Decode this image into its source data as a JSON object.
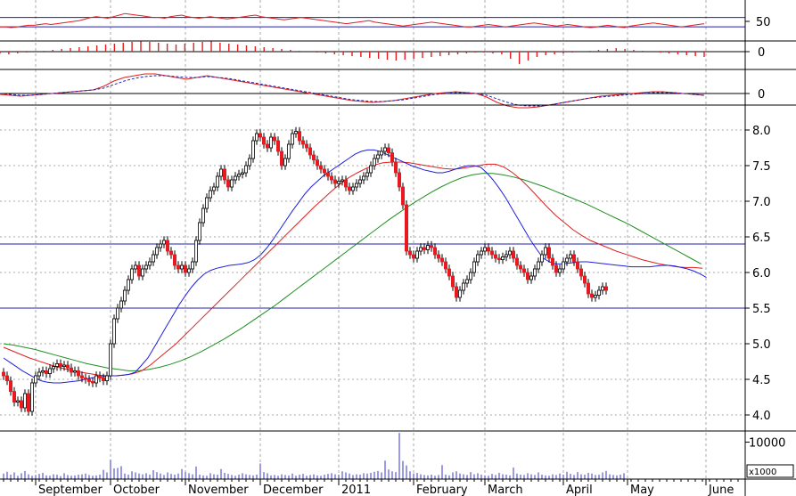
{
  "chart_data": {
    "type": "candlestick",
    "grid": true,
    "colors": {
      "background": "#ffffff",
      "up_candle": "#ffffff",
      "down_candle": "#e8191f",
      "candle_outline": "#000000",
      "ma_short": "#1f1fe0",
      "ma_mid": "#e01f1f",
      "ma_long": "#1f8f1f",
      "reference_line": "#1f1fb0",
      "grid": "#a8a8a8",
      "volume": "#3434d0",
      "volume_spike": "#e01f1f"
    },
    "x_labels": [
      {
        "label": "September",
        "day": 9
      },
      {
        "label": "October",
        "day": 30
      },
      {
        "label": "November",
        "day": 51
      },
      {
        "label": "December",
        "day": 72
      },
      {
        "label": "2011",
        "day": 94
      },
      {
        "label": "February",
        "day": 115
      },
      {
        "label": "March",
        "day": 135
      },
      {
        "label": "April",
        "day": 157
      },
      {
        "label": "May",
        "day": 175
      },
      {
        "label": "June",
        "day": 197
      }
    ],
    "price_panel": {
      "y_ticks": [
        4.0,
        4.5,
        5.0,
        5.5,
        6.0,
        6.5,
        7.0,
        7.5,
        8.0
      ],
      "ylim": [
        3.8,
        8.3
      ],
      "scale": "linear",
      "horizontal_lines": [
        6.4,
        5.5
      ],
      "close": [
        4.55,
        4.48,
        4.33,
        4.18,
        4.2,
        4.1,
        4.3,
        4.05,
        4.45,
        4.55,
        4.6,
        4.62,
        4.58,
        4.65,
        4.68,
        4.72,
        4.68,
        4.7,
        4.66,
        4.6,
        4.62,
        4.55,
        4.52,
        4.5,
        4.47,
        4.45,
        4.55,
        4.52,
        4.48,
        4.55,
        5.0,
        5.35,
        5.5,
        5.6,
        5.75,
        5.9,
        6.05,
        6.1,
        5.95,
        6.05,
        6.1,
        6.15,
        6.25,
        6.35,
        6.4,
        6.45,
        6.3,
        6.25,
        6.1,
        6.05,
        6.1,
        6.0,
        6.05,
        6.15,
        6.45,
        6.7,
        6.9,
        7.05,
        7.15,
        7.2,
        7.35,
        7.45,
        7.3,
        7.2,
        7.3,
        7.35,
        7.38,
        7.4,
        7.5,
        7.6,
        7.85,
        7.95,
        7.9,
        7.8,
        7.75,
        7.9,
        7.85,
        7.7,
        7.5,
        7.6,
        7.8,
        7.95,
        7.98,
        7.85,
        7.8,
        7.75,
        7.65,
        7.58,
        7.5,
        7.45,
        7.4,
        7.35,
        7.3,
        7.25,
        7.28,
        7.3,
        7.2,
        7.15,
        7.2,
        7.25,
        7.3,
        7.35,
        7.4,
        7.5,
        7.6,
        7.65,
        7.7,
        7.75,
        7.68,
        7.55,
        7.4,
        7.2,
        6.95,
        6.3,
        6.25,
        6.2,
        6.3,
        6.35,
        6.32,
        6.38,
        6.35,
        6.25,
        6.2,
        6.15,
        6.05,
        5.95,
        5.8,
        5.65,
        5.75,
        5.85,
        5.9,
        6.0,
        6.15,
        6.25,
        6.3,
        6.35,
        6.3,
        6.25,
        6.2,
        6.18,
        6.22,
        6.25,
        6.3,
        6.2,
        6.1,
        6.05,
        6.0,
        5.9,
        5.95,
        6.05,
        6.15,
        6.25,
        6.35,
        6.2,
        6.1,
        6.0,
        6.05,
        6.15,
        6.2,
        6.25,
        6.15,
        6.05,
        5.95,
        5.85,
        5.7,
        5.65,
        5.68,
        5.75,
        5.8,
        5.75
      ],
      "ma_short": [
        4.8,
        4.74,
        4.68,
        4.62,
        4.57,
        4.52,
        4.48,
        4.46,
        4.45,
        4.45,
        4.46,
        4.47,
        4.48,
        4.5,
        4.52,
        4.53,
        4.54,
        4.55,
        4.55,
        4.56,
        4.57,
        4.6,
        4.7,
        4.8,
        4.95,
        5.1,
        5.25,
        5.4,
        5.55,
        5.68,
        5.8,
        5.9,
        5.98,
        6.03,
        6.06,
        6.08,
        6.1,
        6.11,
        6.12,
        6.14,
        6.18,
        6.25,
        6.35,
        6.47,
        6.6,
        6.73,
        6.86,
        6.98,
        7.1,
        7.2,
        7.28,
        7.36,
        7.42,
        7.48,
        7.54,
        7.6,
        7.66,
        7.7,
        7.72,
        7.72,
        7.7,
        7.66,
        7.62,
        7.58,
        7.54,
        7.5,
        7.47,
        7.44,
        7.42,
        7.4,
        7.4,
        7.42,
        7.45,
        7.48,
        7.5,
        7.5,
        7.48,
        7.4,
        7.3,
        7.18,
        7.05,
        6.9,
        6.75,
        6.6,
        6.45,
        6.32,
        6.2,
        6.15,
        6.12,
        6.12,
        6.13,
        6.14,
        6.15,
        6.15,
        6.14,
        6.13,
        6.12,
        6.11,
        6.1,
        6.09,
        6.08,
        6.08,
        6.08,
        6.08,
        6.09,
        6.1,
        6.1,
        6.09,
        6.07,
        6.05,
        6.02,
        5.98,
        5.93
      ],
      "ma_mid": [
        4.95,
        4.9,
        4.85,
        4.8,
        4.76,
        4.72,
        4.68,
        4.65,
        4.62,
        4.6,
        4.58,
        4.56,
        4.55,
        4.55,
        4.56,
        4.58,
        4.62,
        4.7,
        4.8,
        4.9,
        5.0,
        5.12,
        5.24,
        5.36,
        5.48,
        5.6,
        5.72,
        5.84,
        5.96,
        6.08,
        6.2,
        6.32,
        6.44,
        6.56,
        6.68,
        6.8,
        6.92,
        7.03,
        7.14,
        7.24,
        7.33,
        7.4,
        7.46,
        7.51,
        7.54,
        7.55,
        7.55,
        7.54,
        7.52,
        7.5,
        7.48,
        7.46,
        7.45,
        7.46,
        7.48,
        7.5,
        7.52,
        7.52,
        7.48,
        7.4,
        7.3,
        7.18,
        7.05,
        6.92,
        6.8,
        6.7,
        6.6,
        6.52,
        6.45,
        6.4,
        6.35,
        6.3,
        6.26,
        6.22,
        6.18,
        6.15,
        6.12,
        6.1,
        6.08,
        6.07,
        6.07,
        6.06
      ],
      "ma_long": [
        5.0,
        4.98,
        4.95,
        4.92,
        4.88,
        4.84,
        4.8,
        4.76,
        4.72,
        4.69,
        4.66,
        4.64,
        4.62,
        4.62,
        4.64,
        4.67,
        4.71,
        4.76,
        4.82,
        4.89,
        4.97,
        5.05,
        5.14,
        5.23,
        5.33,
        5.43,
        5.53,
        5.64,
        5.75,
        5.86,
        5.97,
        6.08,
        6.19,
        6.3,
        6.41,
        6.52,
        6.63,
        6.74,
        6.84,
        6.94,
        7.03,
        7.12,
        7.2,
        7.27,
        7.33,
        7.37,
        7.39,
        7.39,
        7.37,
        7.34,
        7.3,
        7.25,
        7.2,
        7.14,
        7.08,
        7.02,
        6.96,
        6.89,
        6.82,
        6.75,
        6.68,
        6.6,
        6.52,
        6.44,
        6.36,
        6.28,
        6.2,
        6.12
      ],
      "ma_start_day": {
        "short": 0,
        "mid": 0,
        "long": 0
      },
      "ma_step": {
        "short": 1.76,
        "mid": 2.42,
        "long": 2.92
      }
    },
    "stoch_panel": {
      "y_ticks": [
        50
      ],
      "reference_lines": [
        60,
        36
      ],
      "ylim": [
        0,
        100
      ],
      "values": [
        36,
        36,
        34,
        36,
        38,
        40,
        40,
        42,
        44,
        42,
        44,
        46,
        48,
        50,
        52,
        56,
        60,
        62,
        60,
        58,
        62,
        66,
        70,
        68,
        66,
        64,
        62,
        60,
        60,
        58,
        62,
        64,
        66,
        62,
        60,
        58,
        60,
        62,
        60,
        58,
        56,
        58,
        60,
        62,
        64,
        66,
        62,
        60,
        58,
        56,
        54,
        56,
        58,
        60,
        58,
        56,
        54,
        52,
        50,
        48,
        46,
        44,
        46,
        48,
        50,
        52,
        48,
        46,
        44,
        42,
        40,
        38,
        40,
        42,
        44,
        46,
        48,
        46,
        44,
        42,
        40,
        38,
        36,
        36,
        38,
        40,
        42,
        40,
        38,
        36,
        38,
        40,
        42,
        44,
        46,
        44,
        42,
        40,
        38,
        40,
        42,
        40,
        38,
        36,
        34,
        36,
        38,
        40,
        38,
        36,
        34,
        38,
        40,
        42,
        44,
        46,
        44,
        42,
        40,
        38,
        36,
        38,
        40,
        42,
        44
      ]
    },
    "macd_hist_panel": {
      "y_ticks": [
        0
      ],
      "values": [
        -2,
        -3,
        -2,
        -1,
        0,
        1,
        2,
        3,
        4,
        5,
        6,
        7,
        8,
        9,
        10,
        11,
        12,
        11,
        10,
        9,
        8,
        9,
        10,
        11,
        12,
        10,
        9,
        8,
        7,
        6,
        5,
        4,
        3,
        2,
        1,
        0,
        -1,
        -2,
        -3,
        -4,
        -5,
        -6,
        -7,
        -8,
        -9,
        -10,
        -9,
        -8,
        -7,
        -6,
        -5,
        -4,
        -3,
        -2,
        -1,
        -1,
        -2,
        -3,
        -8,
        -14,
        -10,
        -6,
        -4,
        -3,
        -2,
        -1,
        0,
        1,
        2,
        3,
        4,
        3,
        2,
        1,
        0,
        -1,
        -2,
        -3,
        -4,
        -5,
        -6
      ]
    },
    "macd_line_panel": {
      "y_ticks": [
        0
      ],
      "macd": [
        -1,
        -2,
        -3,
        -2,
        -1,
        0,
        1,
        2,
        3,
        4,
        8,
        14,
        18,
        20,
        22,
        22,
        20,
        18,
        16,
        18,
        20,
        18,
        16,
        14,
        12,
        10,
        8,
        6,
        4,
        2,
        0,
        -2,
        -4,
        -6,
        -8,
        -9,
        -10,
        -9,
        -8,
        -6,
        -4,
        -2,
        0,
        1,
        2,
        1,
        0,
        -4,
        -10,
        -14,
        -16,
        -16,
        -15,
        -13,
        -11,
        -9,
        -7,
        -5,
        -3,
        -2,
        -1,
        0,
        1,
        2,
        2,
        1,
        0,
        -1,
        -2
      ],
      "signal": [
        0,
        -1,
        -2,
        -2,
        -1,
        0,
        1,
        2,
        3,
        4,
        6,
        10,
        14,
        17,
        19,
        20,
        20,
        19,
        18,
        18,
        19,
        18,
        17,
        15,
        13,
        11,
        9,
        7,
        5,
        3,
        1,
        -1,
        -3,
        -5,
        -7,
        -8,
        -9,
        -9,
        -8,
        -7,
        -5,
        -3,
        -1,
        0,
        1,
        1,
        0,
        -2,
        -6,
        -10,
        -13,
        -14,
        -14,
        -13,
        -11,
        -9,
        -7,
        -5,
        -4,
        -3,
        -2,
        -1,
        0,
        1,
        1,
        1,
        0,
        -1,
        -2
      ]
    },
    "volume_panel": {
      "y_ticks": [
        10000
      ],
      "unit_label": "x1000",
      "spike_day": 115,
      "values": [
        1500,
        2000,
        1200,
        1800,
        900,
        1600,
        2200,
        1300,
        900,
        1100,
        1400,
        1700,
        1000,
        900,
        1300,
        1200,
        800,
        1600,
        1100,
        900,
        1000,
        1200,
        1300,
        1500,
        1100,
        900,
        1000,
        1200,
        2500,
        1800,
        5200,
        2900,
        3000,
        3500,
        1500,
        1200,
        2100,
        1800,
        1500,
        1300,
        1600,
        1200,
        2400,
        1900,
        1500,
        1100,
        1800,
        1400,
        1200,
        1500,
        2700,
        1900,
        1600,
        1300,
        3400,
        1200,
        1000,
        900,
        1600,
        1300,
        1200,
        2700,
        1700,
        1400,
        1100,
        900,
        1200,
        1600,
        1300,
        1100,
        1000,
        1200,
        4200,
        1900,
        1600,
        1000,
        1100,
        900,
        1300,
        1100,
        1000,
        1500,
        900,
        1200,
        1400,
        900,
        1100,
        1300,
        1000,
        900,
        1200,
        1400,
        1600,
        1300,
        1200,
        2100,
        1800,
        1500,
        1100,
        1300,
        1200,
        1600,
        1500,
        1700,
        2000,
        2200,
        1800,
        5000,
        2600,
        2100,
        1900,
        12500,
        4900,
        3700,
        2100,
        1500,
        1700,
        1300,
        1100,
        1000,
        1200,
        900,
        1100,
        3800,
        1200,
        1000,
        1800,
        2100,
        1500,
        1300,
        1100,
        1900,
        1300,
        1600,
        1200,
        1000,
        900,
        1400,
        1100,
        1700,
        1300,
        1200,
        1000,
        3100,
        1500,
        1200,
        1100,
        1600,
        1300,
        1100,
        1800,
        1200,
        1000,
        900,
        1300,
        1100,
        1500,
        1200,
        2000,
        1400,
        1100,
        1900,
        1300,
        1200,
        1700,
        1500,
        1100,
        1200,
        1800,
        2200,
        1300,
        1100,
        1000,
        1200,
        1600
      ]
    }
  }
}
